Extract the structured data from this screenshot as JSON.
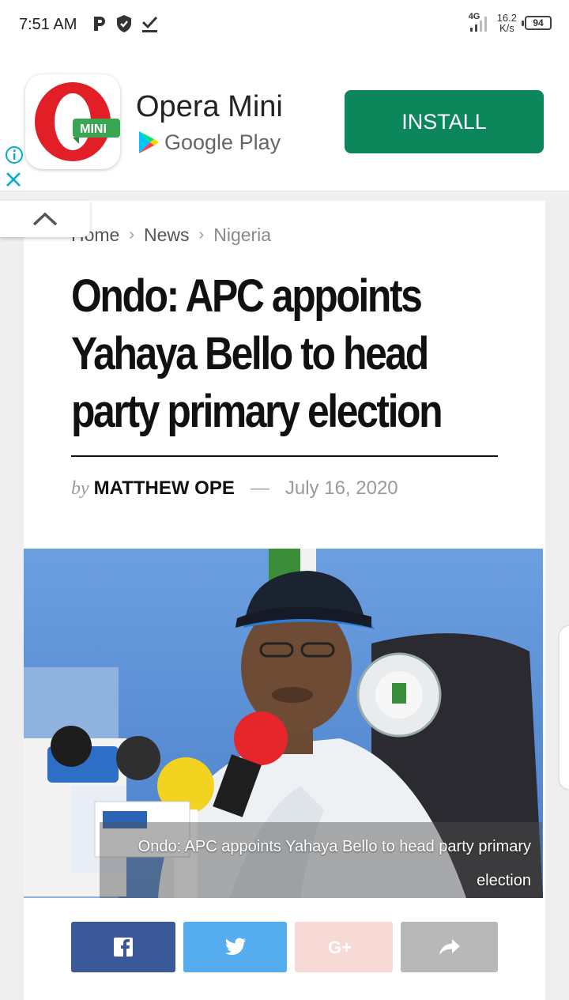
{
  "status_bar": {
    "time": "7:51 AM",
    "network": "4G",
    "speed_value": "16.2",
    "speed_unit": "K/s",
    "battery": "94"
  },
  "ad": {
    "app_name": "Opera Mini",
    "icon_label": "MINI",
    "store": "Google Play",
    "install_label": "INSTALL",
    "colors": {
      "install": "#0b875b",
      "opera_red": "#e21e26",
      "badge_green": "#3aa654"
    }
  },
  "breadcrumb": {
    "home": "Home",
    "news": "News",
    "current": "Nigeria"
  },
  "article": {
    "title": "Ondo: APC appoints Yahaya Bello to head party primary election",
    "by": "by",
    "author": "MATTHEW OPE",
    "dash": "—",
    "date": "July 16, 2020",
    "image_caption": "Ondo: APC appoints Yahaya Bello to head party primary election"
  },
  "share": {
    "buttons": [
      {
        "name": "facebook",
        "icon": "facebook-icon",
        "color": "#3b5998"
      },
      {
        "name": "twitter",
        "icon": "twitter-icon",
        "color": "#55acee"
      },
      {
        "name": "google-plus",
        "icon": "google-plus-icon",
        "color": "#f7d9d6"
      },
      {
        "name": "share",
        "icon": "share-icon",
        "color": "#b8b8b8"
      }
    ]
  }
}
